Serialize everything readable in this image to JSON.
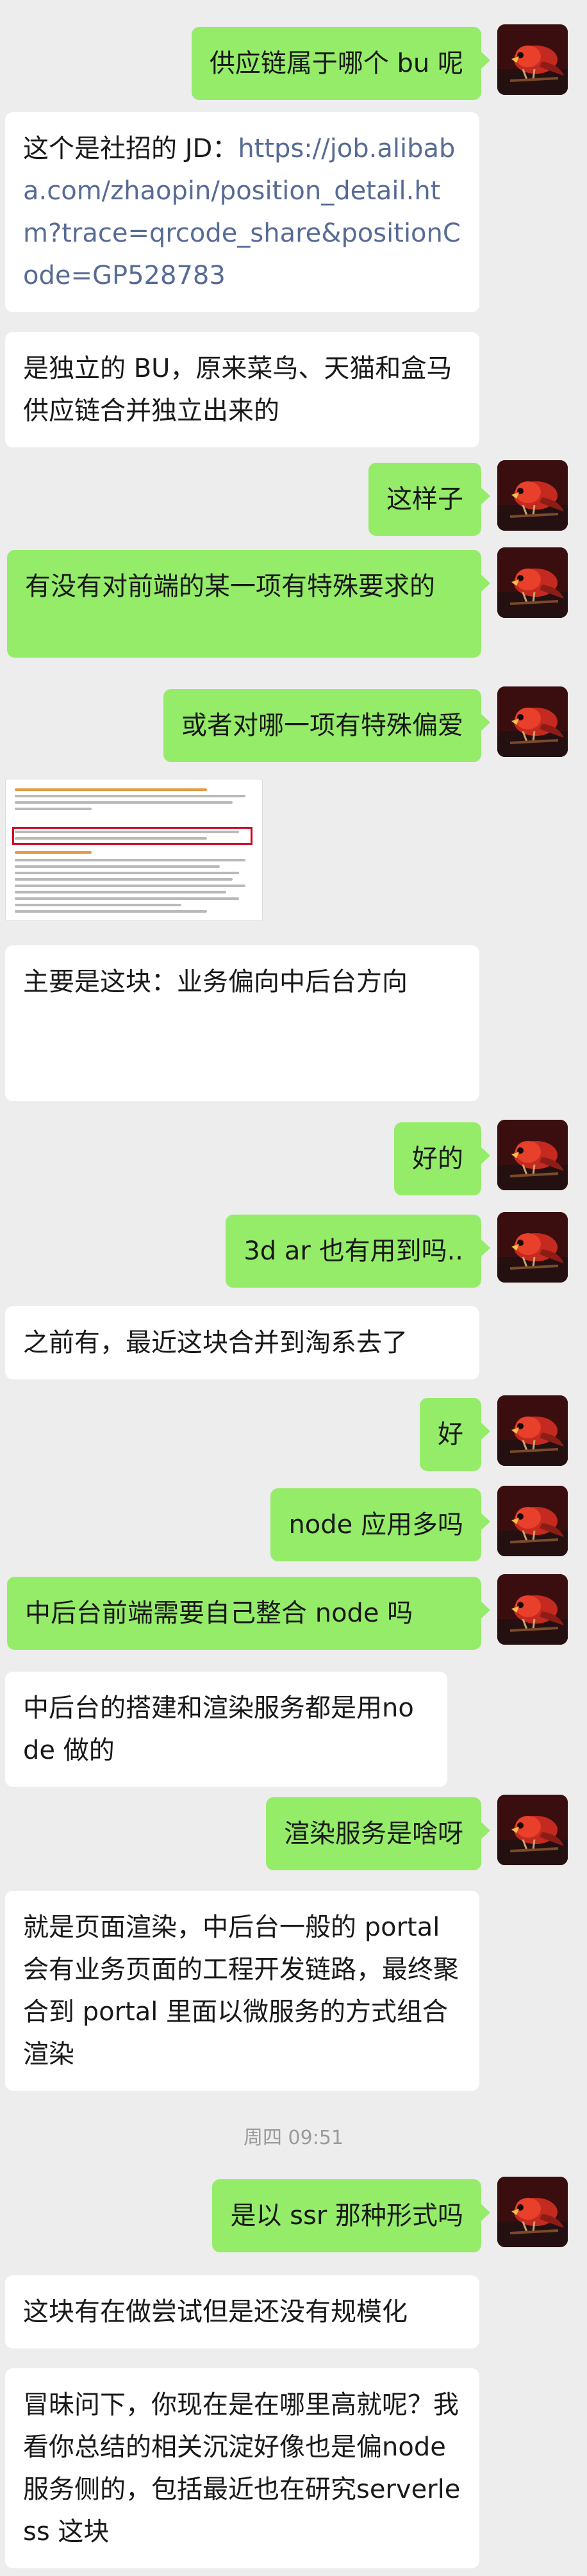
{
  "messages": [
    {
      "side": "out",
      "text": "供应链属于哪个 bu 呢"
    },
    {
      "side": "in",
      "prefix": "这个是社招的 JD：",
      "link": "https://job.alibaba.com/zhaopin/position_detail.htm?trace=qrcode_share&positionCode=GP528783"
    },
    {
      "side": "in",
      "text": "是独立的 BU，原来菜鸟、天猫和盒马供应链合并独立出来的"
    },
    {
      "side": "out",
      "text": "这样子"
    },
    {
      "side": "out",
      "text": "有没有对前端的某一项有特殊要求的"
    },
    {
      "side": "out",
      "text": "或者对哪一项有特殊偏爱"
    },
    {
      "side": "in",
      "type": "image"
    },
    {
      "side": "in",
      "text": "主要是这块：业务偏向中后台方向"
    },
    {
      "side": "out",
      "text": "好的"
    },
    {
      "side": "out",
      "text": "3d ar 也有用到吗.."
    },
    {
      "side": "in",
      "text": "之前有，最近这块合并到淘系去了"
    },
    {
      "side": "out",
      "text": "好"
    },
    {
      "side": "out",
      "text": "node 应用多吗"
    },
    {
      "side": "out",
      "text": "中后台前端需要自己整合 node 吗"
    },
    {
      "side": "in",
      "text": "中后台的搭建和渲染服务都是用node 做的"
    },
    {
      "side": "out",
      "text": "渲染服务是啥呀"
    },
    {
      "side": "in",
      "text": "就是页面渲染，中后台一般的 portal会有业务页面的工程开发链路，最终聚合到 portal 里面以微服务的方式组合渲染"
    },
    {
      "type": "timestamp",
      "text": "周四 09:51"
    },
    {
      "side": "out",
      "text": "是以 ssr 那种形式吗"
    },
    {
      "side": "in",
      "text": "这块有在做尝试但是还没有规模化"
    },
    {
      "side": "in",
      "text": "冒昧问下，你现在是在哪里高就呢？我看你总结的相关沉淀好像也是偏node 服务侧的，包括最近也在研究serverless 这块"
    }
  ],
  "colors": {
    "background": "#ededed",
    "outgoing_bubble": "#95ec69",
    "incoming_bubble": "#ffffff",
    "link": "#576b95",
    "timestamp": "#9a9a9a"
  },
  "icons": {
    "avatar": "red-parrot-avatar-icon"
  }
}
